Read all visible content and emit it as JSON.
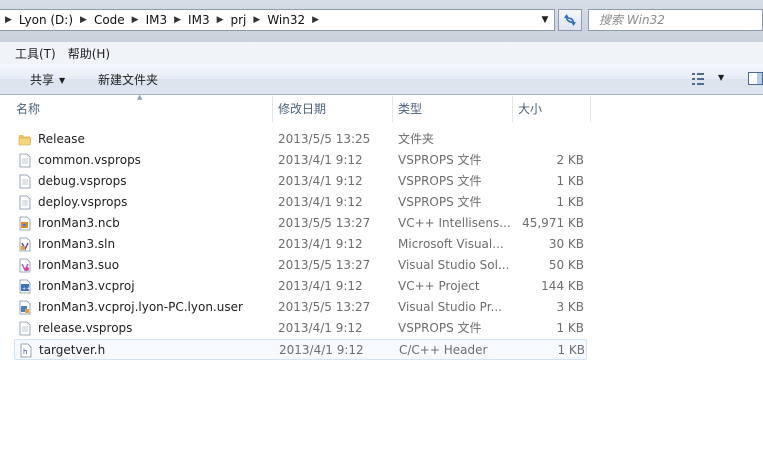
{
  "address_bar": {
    "crumbs": [
      "Lyon (D:)",
      "Code",
      "IM3",
      "IM3",
      "prj",
      "Win32"
    ]
  },
  "search": {
    "placeholder": "搜索 Win32"
  },
  "menu": {
    "tools": "工具(T)",
    "help": "帮助(H)"
  },
  "toolbar": {
    "share": "共享",
    "new_folder": "新建文件夹"
  },
  "columns": {
    "name": "名称",
    "date": "修改日期",
    "type": "类型",
    "size": "大小"
  },
  "files": [
    {
      "name": "Release",
      "date": "2013/5/5 13:25",
      "type": "文件夹",
      "size": "",
      "icon": "folder-icon"
    },
    {
      "name": "common.vsprops",
      "date": "2013/4/1 9:12",
      "type": "VSPROPS 文件",
      "size": "2 KB",
      "icon": "document-icon"
    },
    {
      "name": "debug.vsprops",
      "date": "2013/4/1 9:12",
      "type": "VSPROPS 文件",
      "size": "1 KB",
      "icon": "document-icon"
    },
    {
      "name": "deploy.vsprops",
      "date": "2013/4/1 9:12",
      "type": "VSPROPS 文件",
      "size": "1 KB",
      "icon": "document-icon"
    },
    {
      "name": "IronMan3.ncb",
      "date": "2013/5/5 13:27",
      "type": "VC++ Intellisens...",
      "size": "45,971 KB",
      "icon": "vc-intellisense-icon"
    },
    {
      "name": "IronMan3.sln",
      "date": "2013/4/1 9:12",
      "type": "Microsoft Visual...",
      "size": "30 KB",
      "icon": "visual-studio-solution-icon"
    },
    {
      "name": "IronMan3.suo",
      "date": "2013/5/5 13:27",
      "type": "Visual Studio Sol...",
      "size": "50 KB",
      "icon": "solution-options-icon"
    },
    {
      "name": "IronMan3.vcproj",
      "date": "2013/4/1 9:12",
      "type": "VC++ Project",
      "size": "144 KB",
      "icon": "vc-project-icon"
    },
    {
      "name": "IronMan3.vcproj.lyon-PC.lyon.user",
      "date": "2013/5/5 13:27",
      "type": "Visual Studio Pr...",
      "size": "3 KB",
      "icon": "vs-project-user-icon"
    },
    {
      "name": "release.vsprops",
      "date": "2013/4/1 9:12",
      "type": "VSPROPS 文件",
      "size": "1 KB",
      "icon": "document-icon"
    },
    {
      "name": "targetver.h",
      "date": "2013/4/1 9:12",
      "type": "C/C++ Header",
      "size": "1 KB",
      "icon": "header-file-icon"
    }
  ],
  "selected_index": 10
}
